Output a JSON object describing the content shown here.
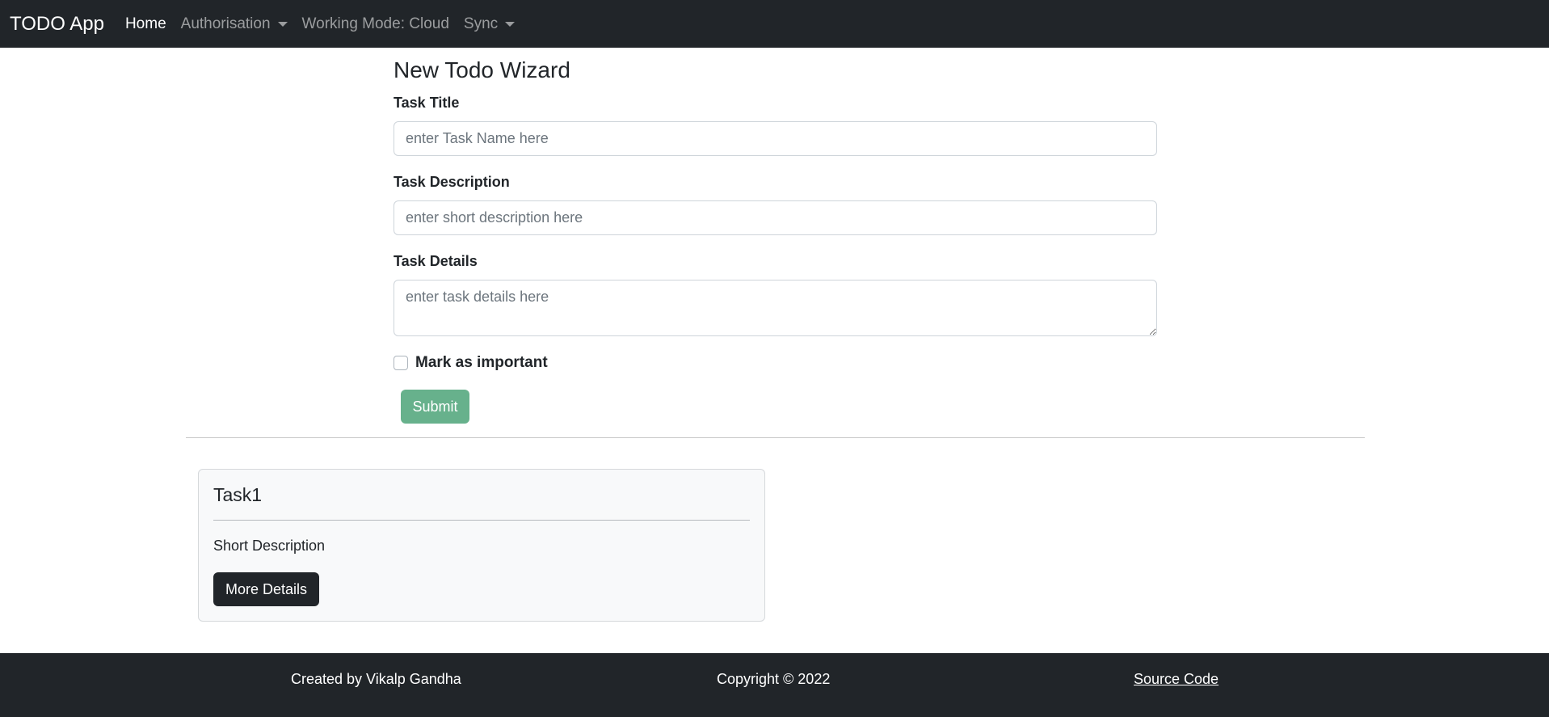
{
  "navbar": {
    "brand": "TODO App",
    "links": [
      {
        "label": "Home",
        "active": true
      },
      {
        "label": "Authorisation",
        "dropdown": true
      },
      {
        "label": "Working Mode: Cloud"
      },
      {
        "label": "Sync",
        "dropdown": true
      }
    ]
  },
  "form": {
    "title": "New Todo Wizard",
    "task_title_label": "Task Title",
    "task_title_placeholder": "enter Task Name here",
    "task_title_value": "",
    "task_description_label": "Task Description",
    "task_description_placeholder": "enter short description here",
    "task_description_value": "",
    "task_details_label": "Task Details",
    "task_details_placeholder": "enter task details here",
    "task_details_value": "",
    "important_label": "Mark as important",
    "important_checked": false,
    "submit_label": "Submit"
  },
  "tasks": [
    {
      "title": "Task1",
      "description": "Short Description",
      "button_label": "More Details"
    }
  ],
  "footer": {
    "created_by": "Created by Vikalp Gandha",
    "copyright": "Copyright © 2022",
    "source_link": "Source Code"
  },
  "colors": {
    "navbar_bg": "#212529",
    "submit_bg": "#67b18c",
    "card_bg": "#f8f9fa",
    "footer_bg": "#212529"
  }
}
